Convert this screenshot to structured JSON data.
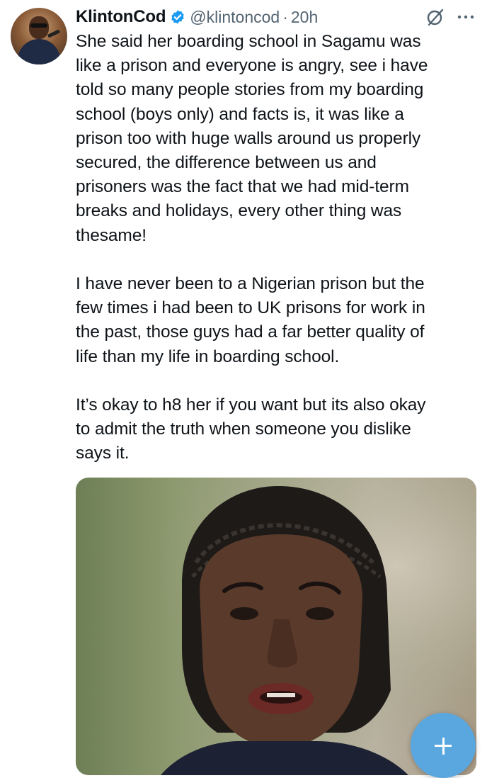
{
  "tweet": {
    "author_name": "KlintonCod",
    "handle": "@klintoncod",
    "separator": "·",
    "time": "20h",
    "text": "She said her boarding school in Sagamu was\nlike a prison and everyone is angry, see i have\ntold so many people stories from my boarding\nschool (boys only) and facts is, it was like a\nprison too with huge walls around us properly\nsecured, the difference between us and\nprisoners was the fact that we had mid-term\nbreaks and holidays, every other thing was\nthesame!\n\nI have never been to a Nigerian prison but the\nfew times i had been to UK prisons for work in\nthe past, those guys had a far better quality of\nlife than my life in boarding school.\n\nIt’s okay to h8 her if you want but its also okay\nto admit the truth when someone you dislike\nsays it."
  },
  "icons": {
    "verified": "verified-badge-icon",
    "grok": "grok-icon",
    "more": "more-options-icon",
    "compose": "plus-icon"
  },
  "colors": {
    "text": "#0f1419",
    "secondary": "#536471",
    "verified": "#1d9bf0",
    "fab": "#5aa7e0"
  }
}
